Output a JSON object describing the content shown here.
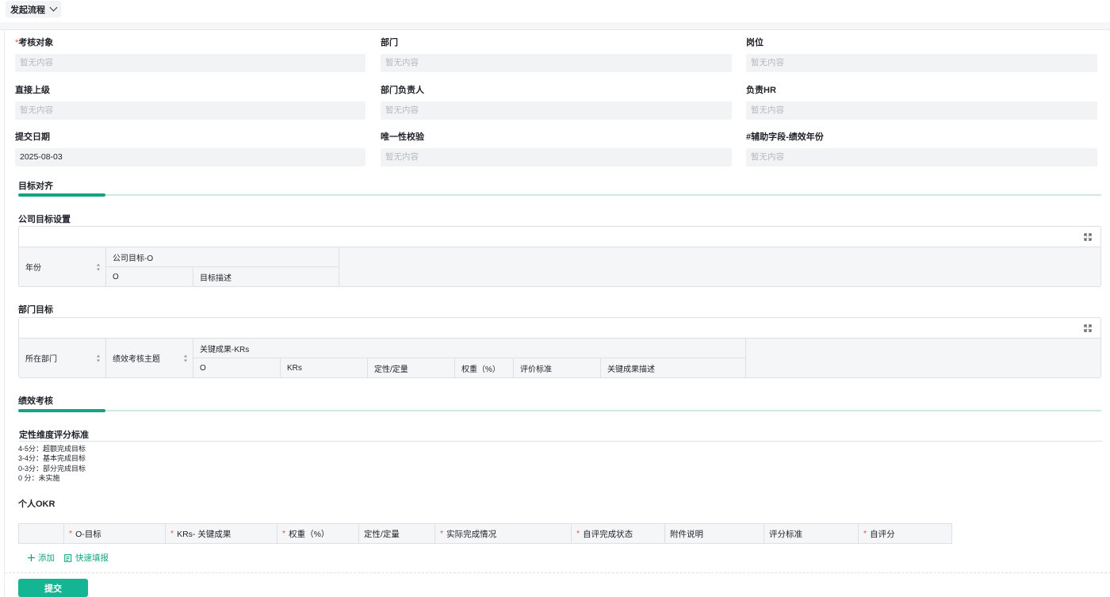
{
  "header": {
    "flow_label": "发起流程"
  },
  "fields": [
    {
      "label": "考核对象",
      "required": "*",
      "value": "暂无内容"
    },
    {
      "label": "部门",
      "value": "暂无内容"
    },
    {
      "label": "岗位",
      "value": "暂无内容"
    },
    {
      "label": "直接上级",
      "value": "暂无内容"
    },
    {
      "label": "部门负责人",
      "value": "暂无内容"
    },
    {
      "label": "负责HR",
      "value": "暂无内容"
    },
    {
      "label": "提交日期",
      "value": "2025-08-03"
    },
    {
      "label": "唯一性校验",
      "value": "暂无内容"
    },
    {
      "label": "#辅助字段-绩效年份",
      "value": "暂无内容"
    }
  ],
  "section_goal": {
    "title": "目标对齐"
  },
  "company_goal": {
    "title": "公司目标设置",
    "col_year": "年份",
    "group": "公司目标-O",
    "col_o": "O",
    "col_desc": "目标描述"
  },
  "dept_goal": {
    "title": "部门目标",
    "col_dept": "所在部门",
    "col_theme": "绩效考核主题",
    "group": "关键成果-KRs",
    "cols": [
      "O",
      "KRs",
      "定性/定量",
      "权重（%）",
      "评价标准",
      "关键成果描述"
    ]
  },
  "section_perf": {
    "title": "绩效考核"
  },
  "standard": {
    "title": "定性维度评分标准",
    "lines": [
      "4-5分：超额完成目标",
      "3-4分：基本完成目标",
      "0-3分：部分完成目标",
      "0 分：未实施"
    ]
  },
  "okr": {
    "title": "个人OKR",
    "required_mark": "*",
    "cols": [
      {
        "label": "O-目标",
        "required": true
      },
      {
        "label": "KRs- 关键成果",
        "required": true
      },
      {
        "label": "权重（%）",
        "required": true
      },
      {
        "label": "定性/定量",
        "required": false
      },
      {
        "label": "实际完成情况",
        "required": true
      },
      {
        "label": "自评完成状态",
        "required": true
      },
      {
        "label": "附件说明",
        "required": false
      },
      {
        "label": "评分标准",
        "required": false
      },
      {
        "label": "自评分",
        "required": true
      }
    ],
    "add_label": "添加",
    "quick_fill_label": "快速填报"
  },
  "submit_label": "提交",
  "colors": {
    "accent": "#13a583",
    "required": "#f54a45",
    "placeholder": "#b6b9be"
  }
}
